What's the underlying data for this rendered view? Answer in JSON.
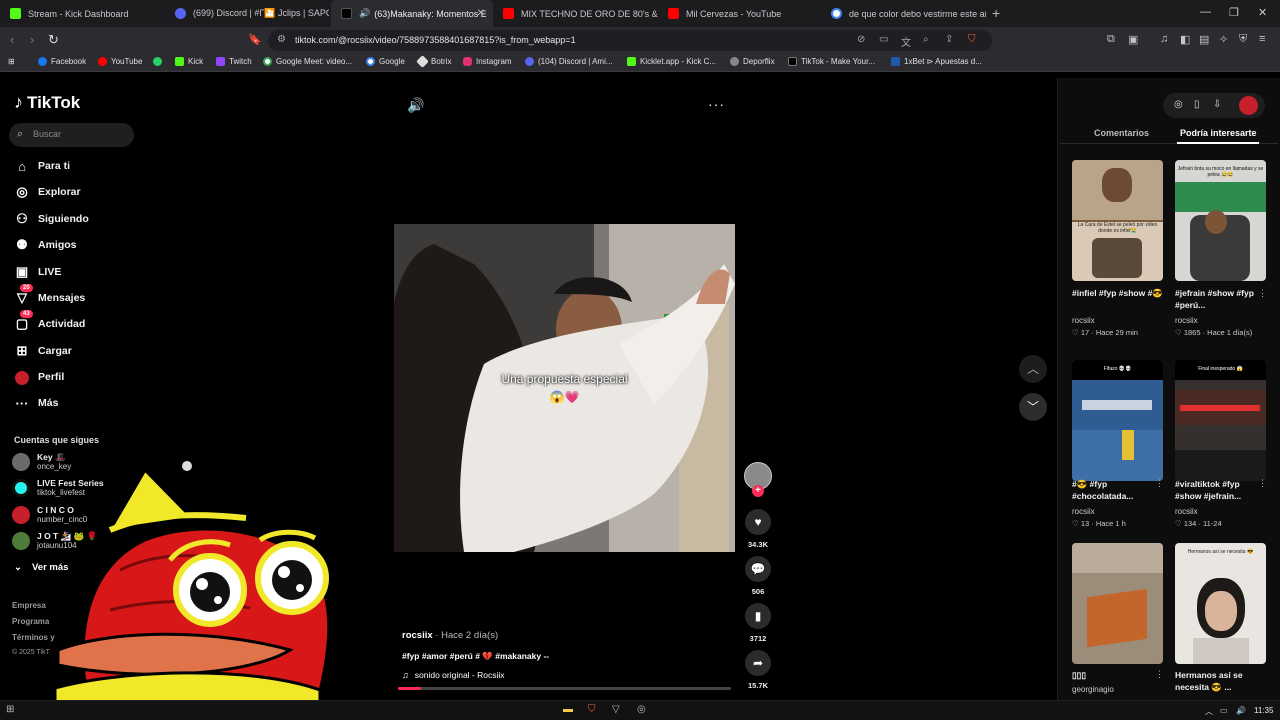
{
  "browser": {
    "tabs": [
      {
        "label": "Stream - Kick Dashboard",
        "color": "#53fc18"
      },
      {
        "label": "(699) Discord | #Γ🎦 Jclips | SAPOLIO",
        "color": "#5865f2"
      },
      {
        "label": "(63)Makanaky: Momentos Esp",
        "color": "#111111"
      },
      {
        "label": "MIX TECHNO DE ORO DE 80's & 90's",
        "color": "#ff0000"
      },
      {
        "label": "Mil Cervezas - YouTube",
        "color": "#ff0000"
      },
      {
        "label": "de que color debo vestirme este año",
        "color": "#4285f4"
      }
    ],
    "url": "tiktok.com/@rocsiix/video/7588973588401687815?is_from_webapp=1",
    "bookmarks": [
      {
        "label": "Facebook",
        "color": "#1877f2"
      },
      {
        "label": "YouTube",
        "color": "#ff0000"
      },
      {
        "label": "",
        "color": "#25d366"
      },
      {
        "label": "Kick",
        "color": "#53fc18"
      },
      {
        "label": "Twitch",
        "color": "#9146ff"
      },
      {
        "label": "Google Meet: video...",
        "color": "#34a853"
      },
      {
        "label": "Google",
        "color": "#4285f4"
      },
      {
        "label": "Botrix",
        "color": "#dddddd"
      },
      {
        "label": "Instagram",
        "color": "#e1306c"
      },
      {
        "label": "(104) Discord | Ami...",
        "color": "#5865f2"
      },
      {
        "label": "Kicklet.app - Kick C...",
        "color": "#53fc18"
      },
      {
        "label": "Deporflix",
        "color": "#888888"
      },
      {
        "label": "TikTok - Make Your...",
        "color": "#111111"
      },
      {
        "label": "1xBet ⊳ Apuestas d...",
        "color": "#1e5aa8"
      }
    ]
  },
  "tiktok": {
    "logo": "TikTok",
    "search_placeholder": "Buscar",
    "nav": [
      {
        "label": "Para ti",
        "icon": "home-icon",
        "badge": ""
      },
      {
        "label": "Explorar",
        "icon": "compass-icon",
        "badge": ""
      },
      {
        "label": "Siguiendo",
        "icon": "following-icon",
        "badge": ""
      },
      {
        "label": "Amigos",
        "icon": "friends-icon",
        "badge": ""
      },
      {
        "label": "LIVE",
        "icon": "live-icon",
        "badge": ""
      },
      {
        "label": "Mensajes",
        "icon": "messages-icon",
        "badge": "20"
      },
      {
        "label": "Actividad",
        "icon": "activity-icon",
        "badge": "43"
      },
      {
        "label": "Cargar",
        "icon": "upload-icon",
        "badge": ""
      },
      {
        "label": "Perfil",
        "icon": "profile-icon",
        "badge": ""
      },
      {
        "label": "Más",
        "icon": "more-icon",
        "badge": ""
      }
    ],
    "following_title": "Cuentas que sigues",
    "following": [
      {
        "name": "Key 🎩",
        "handle": "once_key",
        "color": "#6b6b6b"
      },
      {
        "name": "LIVE Fest Series",
        "handle": "tiktok_livefest",
        "color": "#25f4ee"
      },
      {
        "name": "C I N C O",
        "handle": "number_cinc0",
        "color": "#c8202a"
      },
      {
        "name": "J O T 🏂 🐸 🌹",
        "handle": "jotaunu104",
        "color": "#4e7a3a"
      }
    ],
    "ver_mas": "Ver más",
    "footer": [
      "Empresa",
      "Programa",
      "Términos y",
      "© 2025 TikT"
    ]
  },
  "video": {
    "caption": "Una propuesta especial",
    "caption_emoji": "😱💗",
    "likes": "34.3K",
    "comments": "506",
    "saves": "3712",
    "shares": "15.7K",
    "author": "rocsiix",
    "ago": " · Hace 2 día(s)",
    "tags": "#fyp #amor #perú # 💔 #makanaky --",
    "sound": "sonido original - Rocsiix",
    "progress": 0.07
  },
  "right": {
    "tab_comments": "Comentarios",
    "tab_interest": "Podría interesarte",
    "items": [
      {
        "title": "#infiel #fyp #show #😎",
        "user": "rocsiix",
        "likes": "17",
        "ago": "Hace 29 min",
        "thumb_text": "La Cara de Estel se peleó por video donde es infiel😭",
        "color": "#7a5b3c"
      },
      {
        "title": "#jefrain #show #fyp #perú...",
        "user": "rocsiix",
        "likes": "1865",
        "ago": "Hace 1 día(s)",
        "thumb_text": "Jefraín bota su moco en llamadas y se pelea 😂😂",
        "color": "#d8d6d2"
      },
      {
        "title": "#😎 #fyp #chocolatada...",
        "user": "rocsiix",
        "likes": "13",
        "ago": "Hace 1 h",
        "thumb_text": "Fifazo 💀💀",
        "color": "#2f5d93"
      },
      {
        "title": "#viraltiktok #fyp #show #jefrain...",
        "user": "rocsiix",
        "likes": "134",
        "ago": "11-24",
        "thumb_text": "Final inesperado 😱",
        "color": "#35302d"
      },
      {
        "title": "▯▯▯",
        "user": "georginagio",
        "likes": "",
        "ago": "",
        "thumb_text": "",
        "color": "#b8612a"
      },
      {
        "title": "Hermanos así se necesita 😎 ...",
        "user": "",
        "likes": "",
        "ago": "",
        "thumb_text": "Hermanos así se necesita 😎",
        "color": "#e9e6e2"
      }
    ]
  },
  "taskbar": {
    "time": "11:35"
  }
}
